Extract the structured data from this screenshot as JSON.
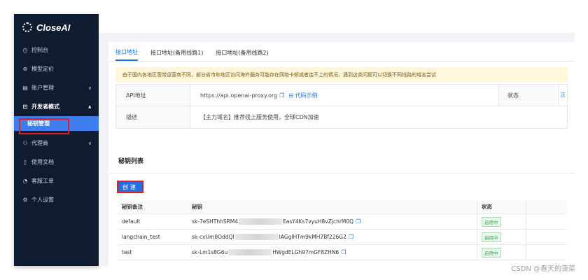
{
  "sidebar": {
    "logo": "CloseAI",
    "items": [
      {
        "icon": "dashboard-icon",
        "glyph": "◷",
        "label": "控制台"
      },
      {
        "icon": "pricing-icon",
        "glyph": "⊚",
        "label": "模型定价"
      },
      {
        "icon": "account-icon",
        "glyph": "▤",
        "label": "账户管理",
        "chevron": "∨"
      },
      {
        "icon": "dev-mode-icon",
        "glyph": "⊡",
        "label": "开发者模式",
        "chevron": "∧"
      },
      {
        "icon": "agent-icon",
        "glyph": "⚇",
        "label": "代理商",
        "chevron": "∨"
      },
      {
        "icon": "docs-icon",
        "glyph": "▯",
        "label": "使用文档"
      },
      {
        "icon": "ticket-icon",
        "glyph": "◔",
        "label": "客服工单"
      },
      {
        "icon": "settings-icon",
        "glyph": "⚙",
        "label": "个人设置"
      }
    ],
    "active_sub": "秘钥管理"
  },
  "tabs": [
    "接口地址",
    "接口地址(备用线路1)",
    "接口地址(备用线路2)"
  ],
  "notice": "由于国内各地区宽带运营商不同，部分省市和地区访问海外服务可能存在网络卡顿或者连不上的情况，遇到这类问题可以切换不同线路的域名尝试",
  "api": {
    "label": "API地址",
    "value": "https://api.openai-proxy.org",
    "example": "代码示例",
    "status_label": "状态",
    "status_edge": "正",
    "desc_label": "描述",
    "desc_value": "【主力域名】推荐线上服务使用，全球CDN加速"
  },
  "keys": {
    "title": "秘钥列表",
    "create": "创建",
    "headers": [
      "秘钥备注",
      "秘钥",
      "状态"
    ],
    "rows": [
      {
        "name": "default",
        "prefix": "sk-7eSHThhSRM4",
        "suffix": "EasY4Ks7vyuH8vZjchrM0Q",
        "status": "启用中"
      },
      {
        "name": "langchain_test",
        "prefix": "sk-cvUm8OddQI",
        "suffix": "IAGgIHTm9kMH7Bf226G2",
        "status": "启用中"
      },
      {
        "name": "test",
        "prefix": "sk-Lm1s8G6u",
        "suffix": "HWgdELGh97mGF8ZHN6",
        "status": "启用中"
      }
    ]
  },
  "watermark": "CSDN @春天的菠菜"
}
